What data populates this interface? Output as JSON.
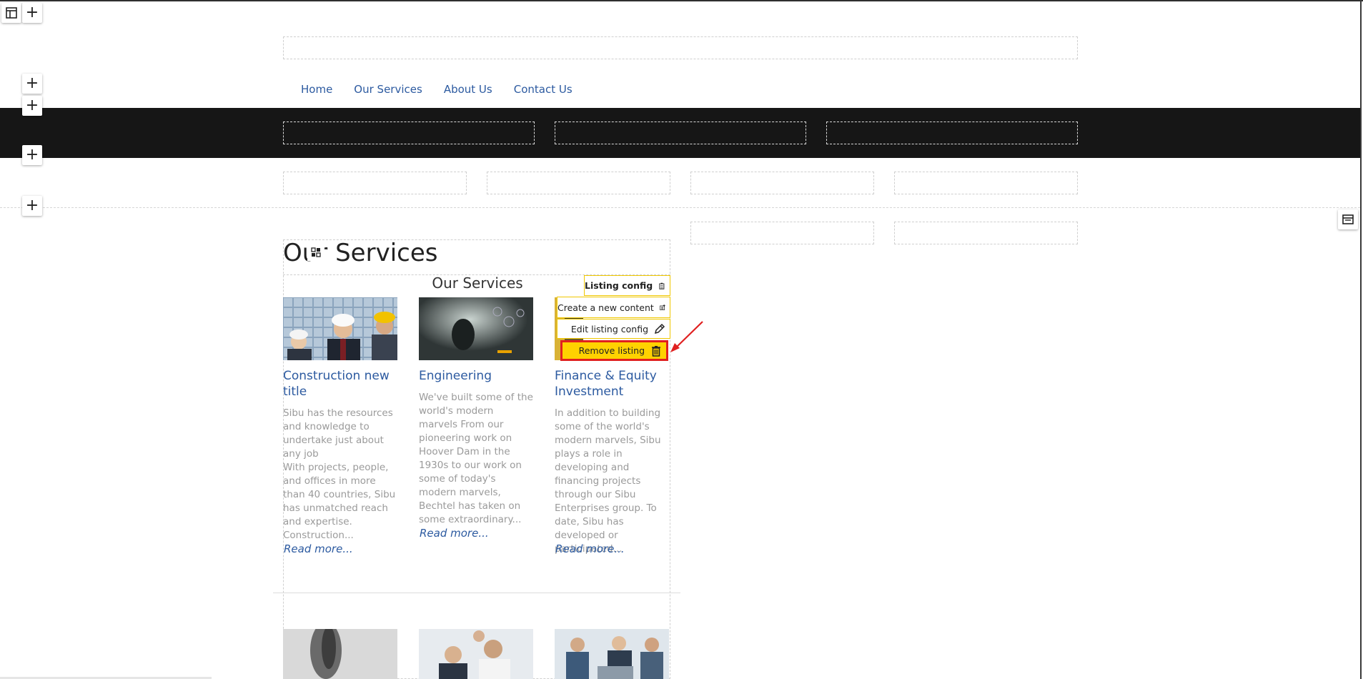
{
  "nav": {
    "items": [
      {
        "label": "Home"
      },
      {
        "label": "Our Services"
      },
      {
        "label": "About Us"
      },
      {
        "label": "Contact Us"
      }
    ]
  },
  "page": {
    "heading": "Our Services"
  },
  "listing": {
    "heading": "Our Services",
    "cards": [
      {
        "title": "Construction new title",
        "text": "Sibu has the resources and knowledge to undertake just about any job\nWith projects, people, and offices in more than 40 countries, Sibu has unmatched reach and expertise. Construction...",
        "more": "Read more..."
      },
      {
        "title": "Engineering",
        "text": "We've built some of the world's modern marvels From our pioneering work on Hoover Dam in the 1930s to our work on some of today's modern marvels, Bechtel has taken on some extraordinary...",
        "more": "Read more..."
      },
      {
        "title": "Finance & Equity Investment",
        "text": "In addition to building some of the world's modern marvels, Sibu plays a role in developing and financing projects through our Sibu Enterprises group. To date, Sibu has developed or participated...",
        "more": "Read more..."
      }
    ]
  },
  "config_menu": {
    "listing_config": "Listing config",
    "create_content": "Create a new content",
    "edit_config": "Edit listing config",
    "remove_listing": "Remove listing"
  },
  "colors": {
    "link": "#2c5aa0",
    "highlight": "#ffd200",
    "annotation": "#e02020",
    "dark_band": "#161616"
  },
  "icons": [
    "layout-icon",
    "plus-icon",
    "grid-icon",
    "clipboard-icon",
    "create-content-icon",
    "pencil-icon",
    "trash-icon",
    "panel-icon",
    "arrow-annotation"
  ]
}
